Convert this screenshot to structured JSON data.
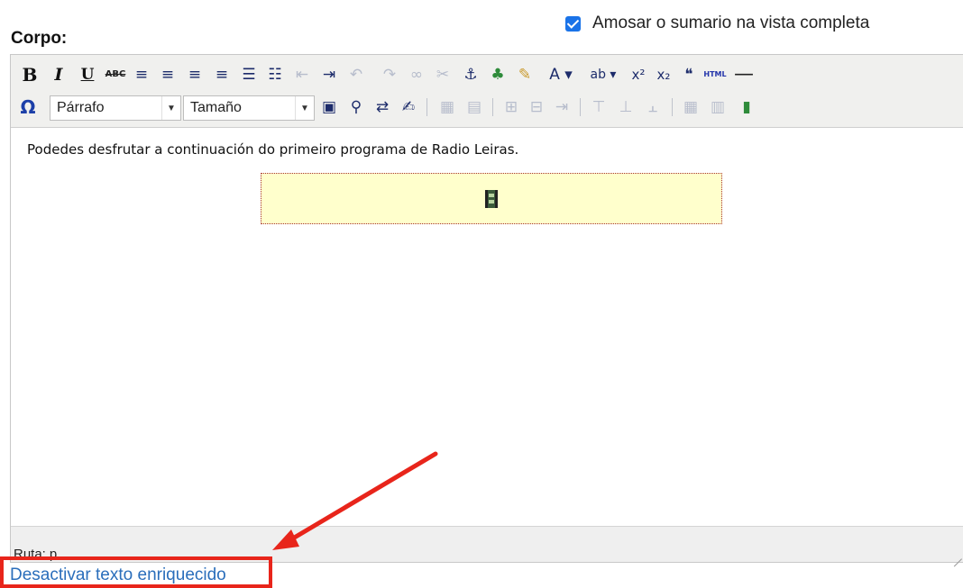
{
  "summary": {
    "checked": true,
    "label": "Amosar o sumario na vista completa"
  },
  "corpo_label": "Corpo:",
  "toolbar": {
    "row1": [
      {
        "name": "bold-button",
        "glyph": "B"
      },
      {
        "name": "italic-button",
        "glyph": "I"
      },
      {
        "name": "underline-button",
        "glyph": "U"
      },
      {
        "name": "strikethrough-button",
        "glyph": "ABC"
      },
      {
        "name": "align-left-button",
        "glyph": "≡"
      },
      {
        "name": "align-center-button",
        "glyph": "≡"
      },
      {
        "name": "align-right-button",
        "glyph": "≡"
      },
      {
        "name": "align-justify-button",
        "glyph": "≡"
      },
      {
        "name": "bullet-list-button",
        "glyph": "☰"
      },
      {
        "name": "numbered-list-button",
        "glyph": "☷"
      },
      {
        "name": "outdent-button",
        "glyph": "⇤"
      },
      {
        "name": "indent-button",
        "glyph": "⇥"
      },
      {
        "name": "undo-button",
        "glyph": "↶"
      },
      {
        "name": "redo-button",
        "glyph": "↷"
      },
      {
        "name": "link-button",
        "glyph": "∞"
      },
      {
        "name": "unlink-button",
        "glyph": "✂"
      },
      {
        "name": "anchor-button",
        "glyph": "⚓"
      },
      {
        "name": "image-button",
        "glyph": "♣"
      },
      {
        "name": "cleanup-button",
        "glyph": "✎"
      },
      {
        "name": "text-color-button",
        "glyph": "A ▾"
      },
      {
        "name": "highlight-color-button",
        "glyph": "ab ▾"
      },
      {
        "name": "superscript-button",
        "glyph": "x²"
      },
      {
        "name": "subscript-button",
        "glyph": "x₂"
      },
      {
        "name": "blockquote-button",
        "glyph": "❝"
      },
      {
        "name": "html-button",
        "glyph": "HTML"
      },
      {
        "name": "horizontal-rule-button",
        "glyph": "—"
      }
    ],
    "charmap_glyph": "Ω",
    "format_select": "Párrafo",
    "size_select": "Tamaño",
    "row2": [
      {
        "name": "fullscreen-button",
        "glyph": "▣"
      },
      {
        "name": "find-button",
        "glyph": "⚲"
      },
      {
        "name": "replace-button",
        "glyph": "⇄"
      },
      {
        "name": "edit-button",
        "glyph": "✍"
      },
      {
        "name": "table-button",
        "glyph": "▦"
      },
      {
        "name": "table-props-button",
        "glyph": "▤"
      },
      {
        "name": "insert-row-before-button",
        "glyph": "⊞"
      },
      {
        "name": "insert-row-after-button",
        "glyph": "⊟"
      },
      {
        "name": "delete-row-button",
        "glyph": "⇥"
      },
      {
        "name": "insert-col-before-button",
        "glyph": "⊤"
      },
      {
        "name": "insert-col-after-button",
        "glyph": "⊥"
      },
      {
        "name": "delete-col-button",
        "glyph": "⫠"
      },
      {
        "name": "merge-cells-button",
        "glyph": "▦"
      },
      {
        "name": "split-cells-button",
        "glyph": "▥"
      },
      {
        "name": "media-button",
        "glyph": "▮"
      }
    ]
  },
  "content": {
    "text": "Podedes desfrutar a continuación do primeiro programa de Radio Leiras."
  },
  "statusbar": {
    "path_label": "Ruta:",
    "path_value": "p"
  },
  "toggle_link": "Desactivar texto enriquecido",
  "colors": {
    "accent_red": "#e8251b",
    "link_blue": "#2a6ebb",
    "checkbox_blue": "#1a73e8"
  }
}
